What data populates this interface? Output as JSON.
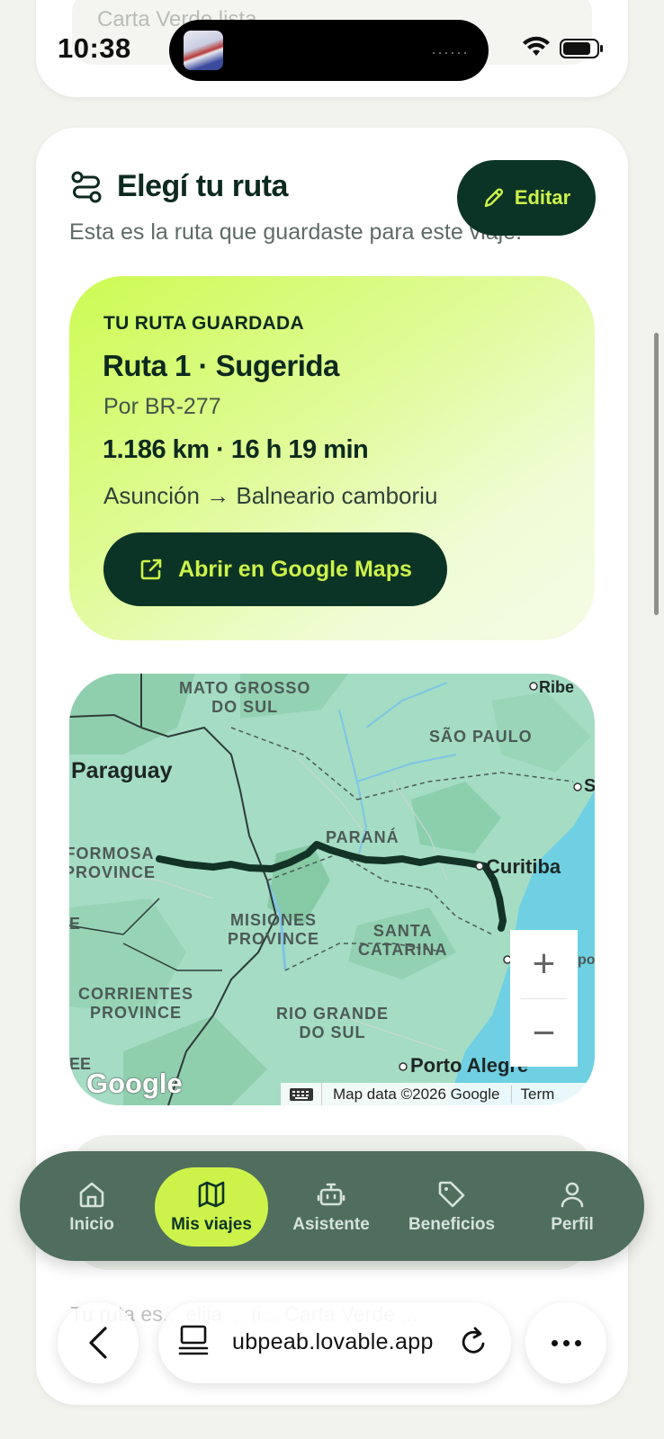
{
  "status_bar": {
    "time": "10:38",
    "island_dots": "······"
  },
  "prev_card": {
    "text": "Carta Verde lista"
  },
  "route_section": {
    "title": "Elegí tu ruta",
    "subtitle": "Esta es la ruta que guardaste para este viaje.",
    "edit_label": "Editar"
  },
  "saved_route": {
    "eyebrow": "TU RUTA GUARDADA",
    "name": "Ruta 1 · Sugerida",
    "via": "Por BR-277",
    "stats": "1.186 km · 16 h 19 min",
    "route": "Asunción → Balneario camboriu",
    "maps_button": "Abrir en Google Maps"
  },
  "map": {
    "regions": [
      "MATO GROSSO\nDO SUL",
      "SÃO PAULO",
      "PARANÁ",
      "MISIONES\nPROVINCE",
      "SANTA\nCATARINA",
      "CORRIENTES\nPROVINCE",
      "RIO GRANDE\nDO SUL",
      "FORMOSA\nPROVINCE"
    ],
    "cities": [
      "Paraguay",
      "Curitiba",
      "Porto Alegre",
      "Ribe",
      "S",
      "E",
      "EE",
      "po"
    ],
    "zoom_in": "+",
    "zoom_out": "−",
    "attribution": "Map data ©2026 Google",
    "terms": "Term",
    "logo": "Google"
  },
  "faded_text": "Tu ruta es... elija ... ti... Carta Verde ...",
  "nav": [
    {
      "label": "Inicio",
      "icon": "home-icon"
    },
    {
      "label": "Mis viajes",
      "icon": "map-icon",
      "active": true
    },
    {
      "label": "Asistente",
      "icon": "bot-icon"
    },
    {
      "label": "Beneficios",
      "icon": "tag-icon"
    },
    {
      "label": "Perfil",
      "icon": "user-icon"
    }
  ],
  "browser": {
    "url": "ubpeab.lovable.app"
  },
  "colors": {
    "accent": "#cdf34a",
    "dark_green": "#0c3426",
    "nav_bg": "#4f6e5d",
    "route_line": "#123326"
  }
}
